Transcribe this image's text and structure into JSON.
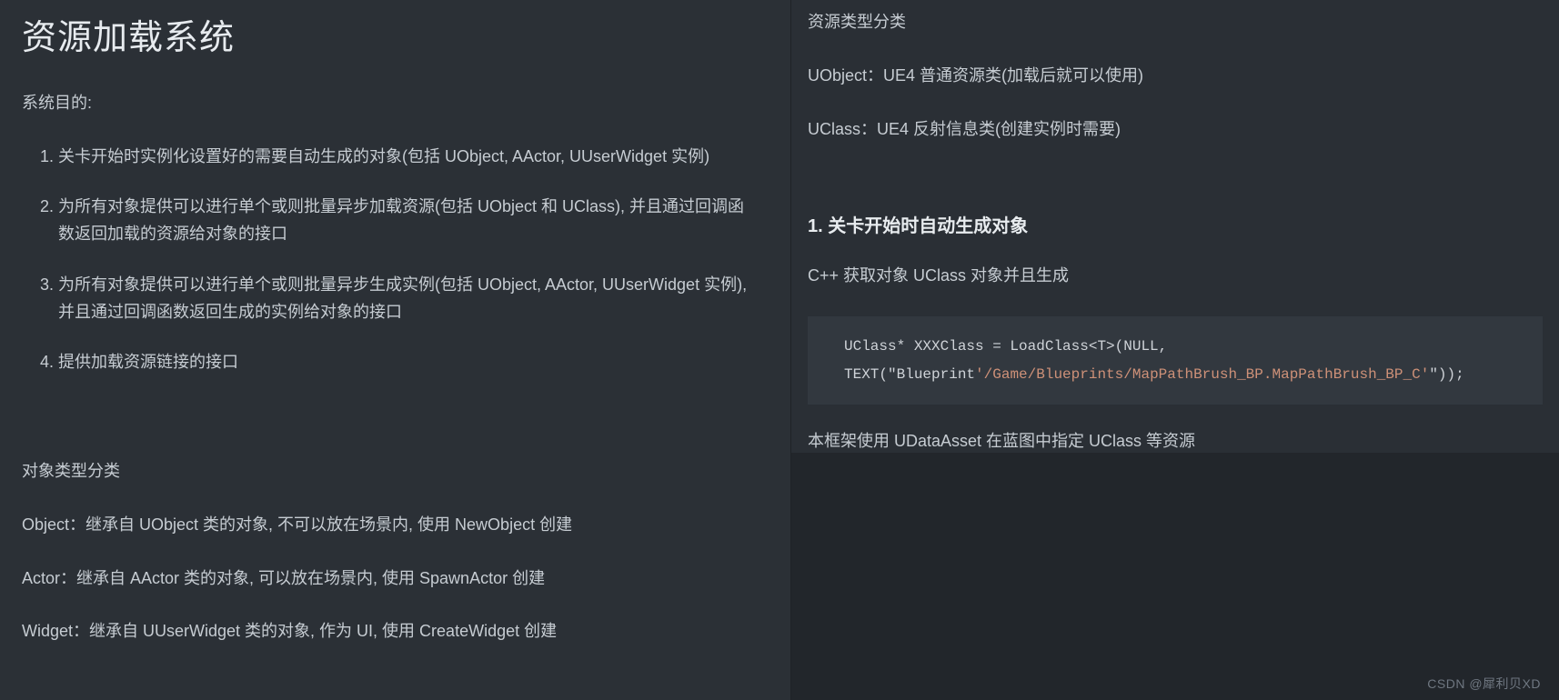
{
  "left": {
    "title": "资源加载系统",
    "goals_label": "系统目的:",
    "goals": [
      "关卡开始时实例化设置好的需要自动生成的对象(包括 UObject, AActor, UUserWidget 实例)",
      "为所有对象提供可以进行单个或则批量异步加载资源(包括 UObject 和 UClass), 并且通过回调函数返回加载的资源给对象的接口",
      "为所有对象提供可以进行单个或则批量异步生成实例(包括 UObject, AActor, UUserWidget 实例), 并且通过回调函数返回生成的实例给对象的接口",
      "提供加载资源链接的接口"
    ],
    "obj_types_label": "对象类型分类",
    "obj_types": [
      "Object：继承自 UObject 类的对象, 不可以放在场景内, 使用 NewObject 创建",
      "Actor：继承自 AActor 类的对象, 可以放在场景内, 使用 SpawnActor 创建",
      "Widget：继承自 UUserWidget 类的对象, 作为 UI, 使用 CreateWidget 创建"
    ]
  },
  "right": {
    "res_types_label": "资源类型分类",
    "res_types": [
      "UObject：UE4 普通资源类(加载后就可以使用)",
      "UClass：UE4 反射信息类(创建实例时需要)"
    ],
    "section1_heading": "1. 关卡开始时自动生成对象",
    "section1_desc": "C++ 获取对象 UClass 对象并且生成",
    "code": {
      "line1": "UClass* XXXClass = LoadClass<T>(NULL,",
      "line2_prefix": "TEXT(\"Blueprint",
      "line2_path": "'/Game/Blueprints/MapPathBrush_BP.MapPathBrush_BP_C'",
      "line2_suffix": "\"));"
    },
    "after_code": "本框架使用 UDataAsset 在蓝图中指定 UClass 等资源"
  },
  "watermark": "CSDN @犀利贝XD"
}
